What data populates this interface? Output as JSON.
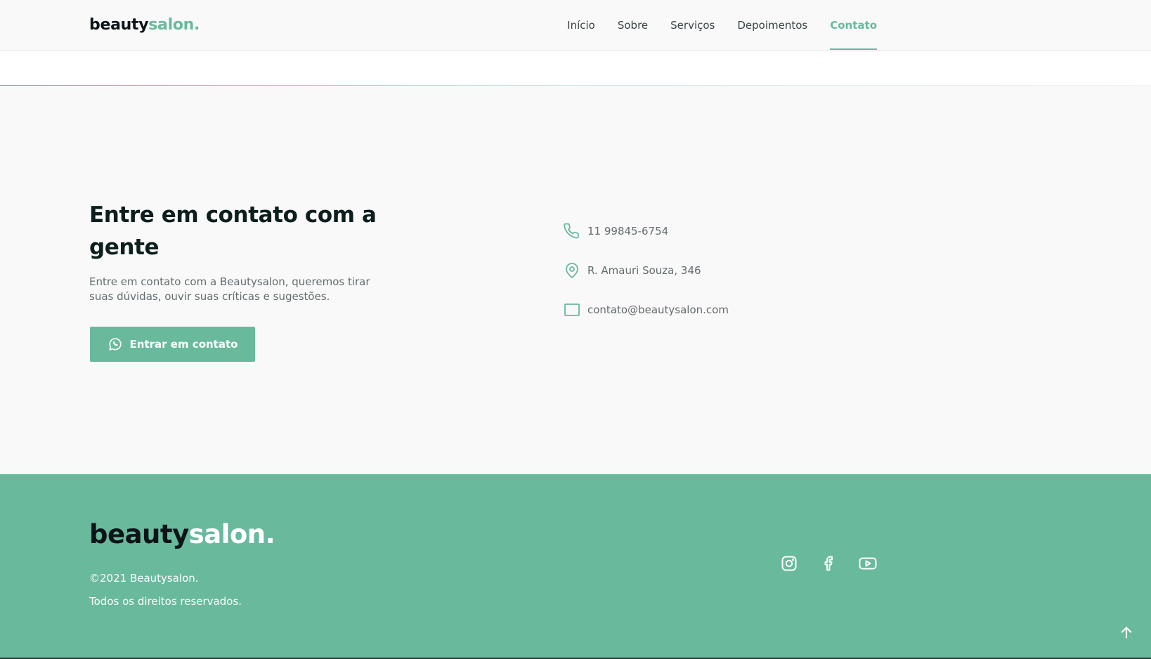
{
  "header": {
    "logo_primary": "beauty",
    "logo_accent": "salon.",
    "nav": [
      {
        "label": "Início",
        "active": false
      },
      {
        "label": "Sobre",
        "active": false
      },
      {
        "label": "Serviços",
        "active": false
      },
      {
        "label": "Depoimentos",
        "active": false
      },
      {
        "label": "Contato",
        "active": true
      }
    ]
  },
  "contact": {
    "title": "Entre em contato com a gente",
    "text": "Entre em contato com a Beautysalon, queremos tirar suas dúvidas, ouvir suas críticas e sugestões.",
    "button_label": "Entrar em contato",
    "button_icon": "whatsapp-icon",
    "info": [
      {
        "icon": "phone-icon",
        "text": "11 99845-6754"
      },
      {
        "icon": "map-pin-icon",
        "text": "R. Amauri Souza, 346"
      },
      {
        "icon": "mail-icon",
        "text": "contato@beautysalon.com"
      }
    ]
  },
  "footer": {
    "logo_primary": "beauty",
    "logo_accent": "salon.",
    "copyright": "©2021 Beautysalon.",
    "rights": "Todos os direitos reservados.",
    "social": [
      "instagram-icon",
      "facebook-icon",
      "youtube-icon"
    ],
    "back_to_top_icon": "arrow-up-icon"
  },
  "colors": {
    "accent": "#69b99d",
    "text_dark": "#0d1418",
    "text_muted": "#636c6f",
    "section_bg": "#f9f9f9"
  }
}
